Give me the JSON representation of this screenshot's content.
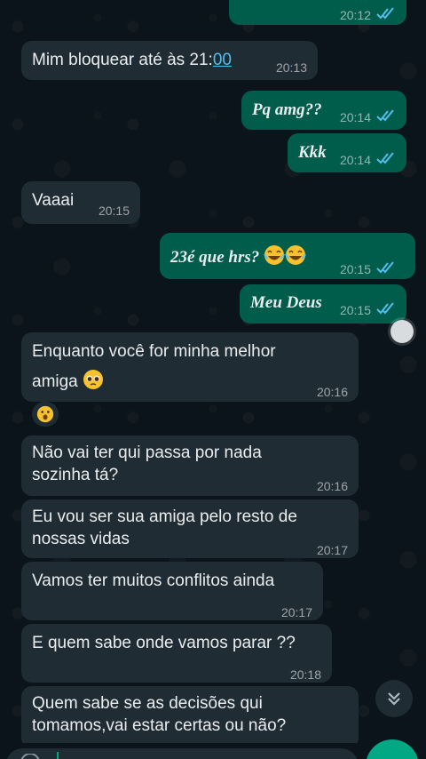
{
  "colors": {
    "background": "#0b141a",
    "incoming_bubble": "#202c33",
    "outgoing_bubble": "#005c4b",
    "read_ticks": "#53bdeb",
    "send_button": "#00a884"
  },
  "messages": [
    {
      "dir": "out",
      "text": "",
      "time": "20:12",
      "status": "read"
    },
    {
      "dir": "in",
      "text_before": "Mim bloquear até às 21:",
      "text_link": "00",
      "time": "20:13"
    },
    {
      "dir": "out",
      "text": "Pq amg??",
      "time": "20:14",
      "status": "read"
    },
    {
      "dir": "out",
      "text": "Kkk",
      "time": "20:14",
      "status": "read"
    },
    {
      "dir": "in",
      "text": "Vaaai",
      "time": "20:15"
    },
    {
      "dir": "out",
      "text": "23é que hrs?",
      "time": "20:15",
      "status": "read",
      "emoji": "laughing-emoji x2"
    },
    {
      "dir": "out",
      "text": "Meu Deus",
      "time": "20:15",
      "status": "read"
    },
    {
      "dir": "in",
      "line1": "Enquanto você for minha melhor",
      "line2": "amiga",
      "time": "20:16",
      "emoji": "pleading-face-emoji"
    },
    {
      "dir": "in",
      "reaction": "astonished-face-emoji"
    },
    {
      "dir": "in",
      "line1": "Não vai ter qui passa por nada",
      "line2": "sozinha tá?",
      "time": "20:16"
    },
    {
      "dir": "in",
      "line1": "Eu vou ser sua amiga pelo resto de",
      "line2": "nossas vidas",
      "time": "20:17"
    },
    {
      "dir": "in",
      "text": "Vamos ter muitos conflitos ainda",
      "time": "20:17"
    },
    {
      "dir": "in",
      "text": "E quem sabe onde vamos parar ??",
      "time": "20:18"
    },
    {
      "dir": "in",
      "line1": "Quem sabe se as decisões qui",
      "line2": "tomamos,vai estar certas ou não?"
    }
  ]
}
